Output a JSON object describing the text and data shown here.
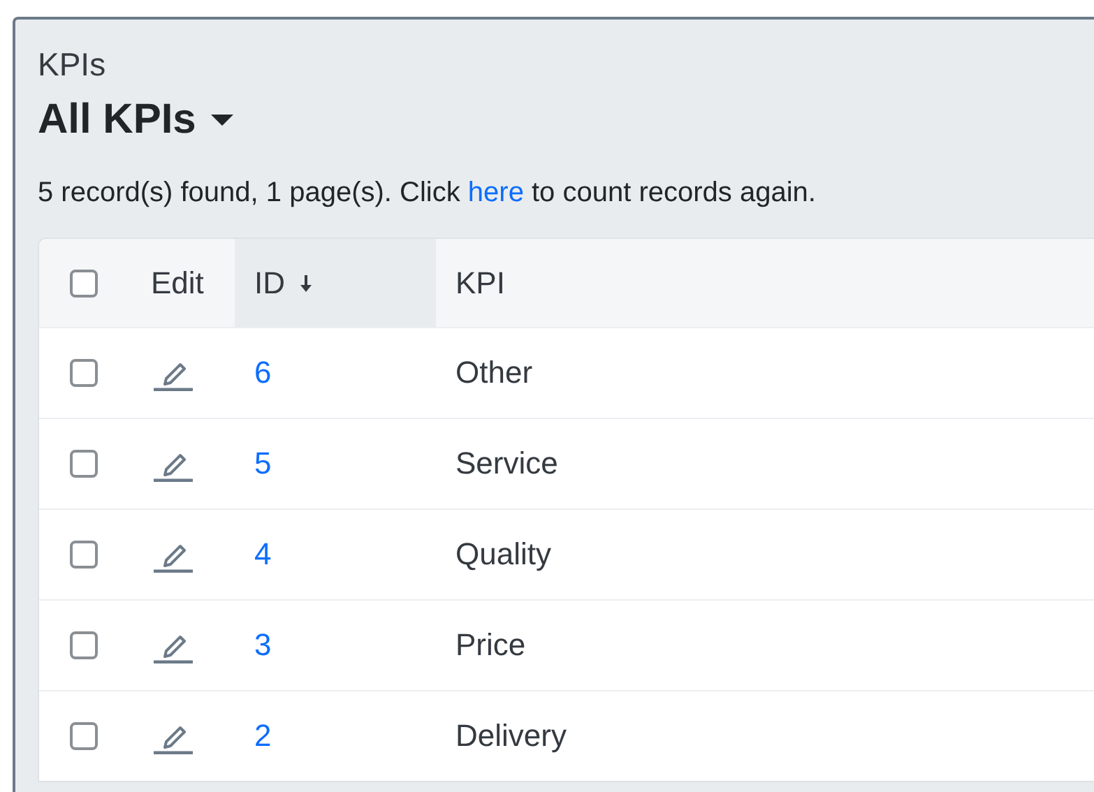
{
  "page": {
    "title": "KPIs",
    "view": "All KPIs"
  },
  "summary": {
    "before": "5 record(s) found, 1 page(s). Click ",
    "link": "here",
    "after": " to count records again."
  },
  "table": {
    "select_all": {
      "checked": false
    },
    "columns": [
      {
        "label": "Edit",
        "sorted": false
      },
      {
        "label": "ID",
        "sorted": true
      },
      {
        "label": "KPI",
        "sorted": false
      }
    ],
    "rows": [
      {
        "checked": false,
        "id": "6",
        "kpi": "Other"
      },
      {
        "checked": false,
        "id": "5",
        "kpi": "Service"
      },
      {
        "checked": false,
        "id": "4",
        "kpi": "Quality"
      },
      {
        "checked": false,
        "id": "3",
        "kpi": "Price"
      },
      {
        "checked": false,
        "id": "2",
        "kpi": "Delivery"
      }
    ]
  }
}
